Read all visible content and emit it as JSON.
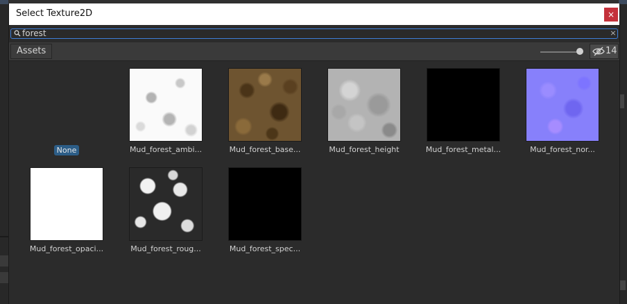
{
  "window": {
    "title": "Select Texture2D",
    "close_label": "×"
  },
  "search": {
    "value": "forest",
    "clear_label": "×"
  },
  "tabs": {
    "assets_label": "Assets"
  },
  "toolbar": {
    "zoom_level": 0.9,
    "hidden_count": "14"
  },
  "assets": {
    "none_label": "None",
    "items": [
      {
        "label": "Mud_forest_ambi..."
      },
      {
        "label": "Mud_forest_base..."
      },
      {
        "label": "Mud_forest_height"
      },
      {
        "label": "Mud_forest_metal..."
      },
      {
        "label": "Mud_forest_nor..."
      },
      {
        "label": "Mud_forest_opaci..."
      },
      {
        "label": "Mud_forest_roug..."
      },
      {
        "label": "Mud_forest_spec..."
      }
    ]
  },
  "colors": {
    "close_button": "#c4313b",
    "search_focus": "#3e7ed8",
    "selection": "#2c5d87"
  }
}
